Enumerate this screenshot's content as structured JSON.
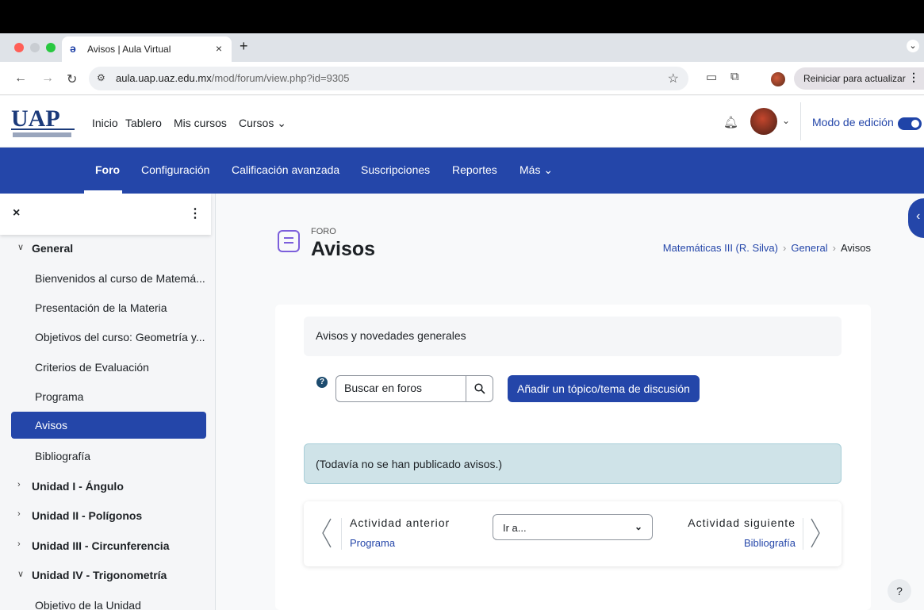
{
  "browser": {
    "tab_title": "Avisos | Aula Virtual",
    "tab_close": "×",
    "new_tab": "+",
    "url_host": "aula.uap.uaz.edu.mx",
    "url_path": "/mod/forum/view.php?id=9305",
    "restart_label": "Reiniciar para actualizar",
    "restart_menu": "⋮"
  },
  "header": {
    "nav": [
      "Inicio",
      "Tablero",
      "Mis cursos",
      "Cursos"
    ],
    "edit_mode_label": "Modo de edición",
    "edit_mode_on": true
  },
  "subnav": {
    "items": [
      "Foro",
      "Configuración",
      "Calificación avanzada",
      "Suscripciones",
      "Reportes",
      "Más"
    ],
    "active": "Foro"
  },
  "drawer": {
    "close": "×",
    "menu": "⋮",
    "items": [
      {
        "label": "General",
        "type": "section",
        "expanded": true
      },
      {
        "label": "Bienvenidos al curso de Matemá...",
        "type": "child"
      },
      {
        "label": "Presentación de la Materia",
        "type": "child"
      },
      {
        "label": "Objetivos del curso: Geometría y...",
        "type": "child"
      },
      {
        "label": "Criterios de Evaluación",
        "type": "child"
      },
      {
        "label": "Programa",
        "type": "child"
      },
      {
        "label": "Avisos",
        "type": "child",
        "selected": true
      },
      {
        "label": "Bibliografía",
        "type": "child"
      },
      {
        "label": "Unidad I - Ángulo",
        "type": "section",
        "expanded": false
      },
      {
        "label": "Unidad II - Polígonos",
        "type": "section",
        "expanded": false
      },
      {
        "label": "Unidad III - Circunferencia",
        "type": "section",
        "expanded": false
      },
      {
        "label": "Unidad IV - Trigonometría",
        "type": "section",
        "expanded": true
      },
      {
        "label": "Objetivo de la Unidad",
        "type": "child"
      }
    ]
  },
  "page": {
    "kicker": "FORO",
    "title": "Avisos",
    "breadcrumb": [
      "Matemáticas III (R. Silva)",
      "General",
      "Avisos"
    ]
  },
  "forum": {
    "intro": "Avisos y novedades generales",
    "search_placeholder": "Buscar en foros",
    "add_button": "Añadir un tópico/tema de discusión",
    "empty_notice": "(Todavía no se han publicado avisos.)",
    "prev_label": "Actividad anterior",
    "prev_link": "Programa",
    "jump_label": "Ir a...",
    "next_label": "Actividad siguiente",
    "next_link": "Bibliografía"
  },
  "help_label": "?",
  "colors": {
    "brand_blue": "#2446a9",
    "notice_bg": "#cfe3e8"
  }
}
